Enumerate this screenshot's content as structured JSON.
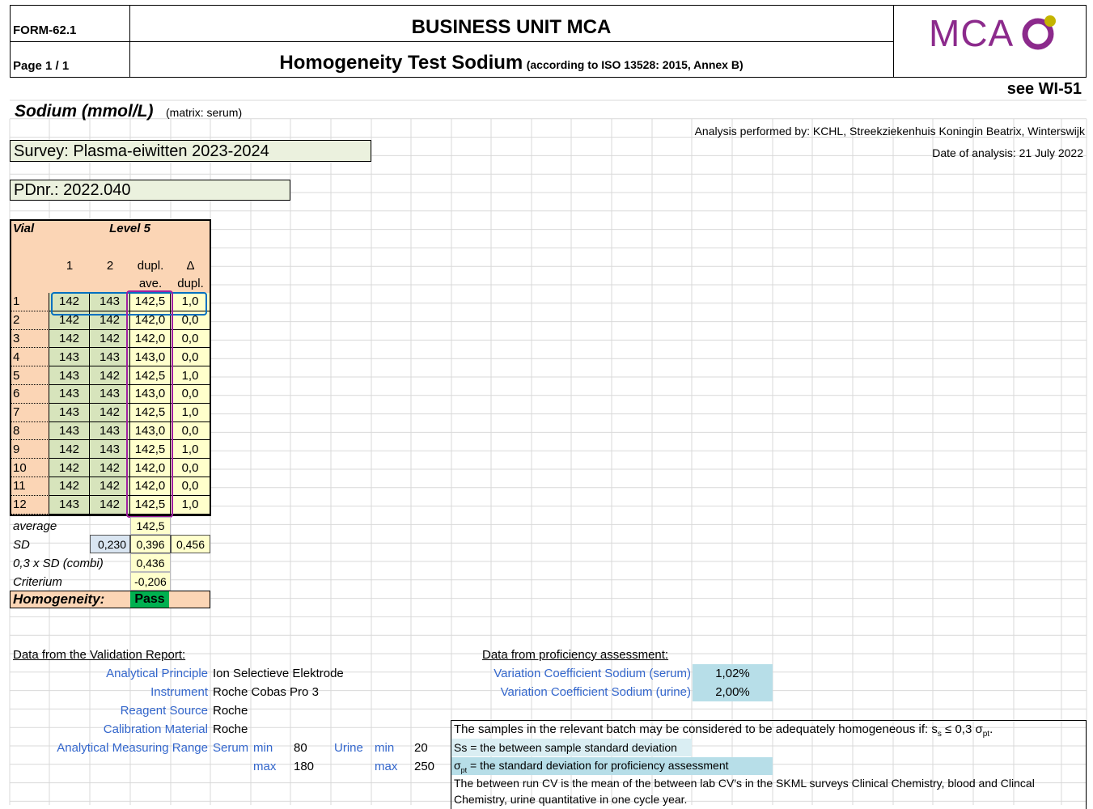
{
  "header": {
    "form_code": "FORM-62.1",
    "page": "Page 1 / 1",
    "unit": "BUSINESS UNIT MCA",
    "title": "Homogeneity Test Sodium",
    "subtitle": "(according to ISO 13528: 2015, Annex B)",
    "logo_text": "MCA",
    "see_wi": "see WI-51"
  },
  "analyte": {
    "name": "Sodium (mmol/L)",
    "matrix": "(matrix: serum)",
    "analysis_by": "Analysis performed by: KCHL, Streekziekenhuis Koningin Beatrix, Winterswijk",
    "date": "Date of analysis:  21 July 2022",
    "survey": "Survey: Plasma-eiwitten 2023-2024",
    "pdnr": "PDnr.: 2022.040"
  },
  "table": {
    "col_vial": "Vial",
    "col_level": "Level 5",
    "col_1": "1",
    "col_2": "2",
    "col_ave_1": "dupl.",
    "col_ave_2": "ave.",
    "col_delta_1": "Δ",
    "col_delta_2": "dupl.",
    "rows": [
      {
        "vial": "1",
        "v1": "142",
        "v2": "143",
        "ave": "142,5",
        "delta": "1,0"
      },
      {
        "vial": "2",
        "v1": "142",
        "v2": "142",
        "ave": "142,0",
        "delta": "0,0"
      },
      {
        "vial": "3",
        "v1": "142",
        "v2": "142",
        "ave": "142,0",
        "delta": "0,0"
      },
      {
        "vial": "4",
        "v1": "143",
        "v2": "143",
        "ave": "143,0",
        "delta": "0,0"
      },
      {
        "vial": "5",
        "v1": "143",
        "v2": "142",
        "ave": "142,5",
        "delta": "1,0"
      },
      {
        "vial": "6",
        "v1": "143",
        "v2": "143",
        "ave": "143,0",
        "delta": "0,0"
      },
      {
        "vial": "7",
        "v1": "143",
        "v2": "142",
        "ave": "142,5",
        "delta": "1,0"
      },
      {
        "vial": "8",
        "v1": "143",
        "v2": "143",
        "ave": "143,0",
        "delta": "0,0"
      },
      {
        "vial": "9",
        "v1": "142",
        "v2": "143",
        "ave": "142,5",
        "delta": "1,0"
      },
      {
        "vial": "10",
        "v1": "142",
        "v2": "142",
        "ave": "142,0",
        "delta": "0,0"
      },
      {
        "vial": "11",
        "v1": "142",
        "v2": "142",
        "ave": "142,0",
        "delta": "0,0"
      },
      {
        "vial": "12",
        "v1": "143",
        "v2": "142",
        "ave": "142,5",
        "delta": "1,0"
      }
    ]
  },
  "stats": {
    "average_label": "average",
    "average": "142,5",
    "sd_label": "SD",
    "sd_between": "0,230",
    "sd_ave": "0,396",
    "sd_delta": "0,456",
    "combi_label": "0,3 x SD (combi)",
    "combi": "0,436",
    "criterium_label": "Criterium",
    "criterium": "-0,206",
    "homogeneity_label": "Homogeneity:",
    "homogeneity": "Pass"
  },
  "validation": {
    "heading": "Data from the Validation Report:",
    "principle_label": "Analytical Principle",
    "principle": "Ion Selectieve Elektrode",
    "instrument_label": "Instrument",
    "instrument": "Roche Cobas Pro 3",
    "reagent_label": "Reagent Source",
    "reagent": "Roche",
    "calibration_label": "Calibration Material",
    "calibration": "Roche",
    "range_label": "Analytical Measuring Range",
    "serum_label": "Serum",
    "urine_label": "Urine",
    "min_label": "min",
    "max_label": "max",
    "serum_min": "80",
    "serum_max": "180",
    "urine_min": "20",
    "urine_max": "250"
  },
  "proficiency": {
    "heading": "Data from proficiency assessment:",
    "cv_serum_label": "Variation Coefficient Sodium (serum)",
    "cv_serum": "1,02%",
    "cv_urine_label": "Variation Coefficient Sodium (urine)",
    "cv_urine": "2,00%"
  },
  "notes": {
    "line1_prefix": "The samples in the relevant batch may be considered to be adequately homogeneous if: s",
    "line1_sub_s": "s",
    "line1_mid": " ≤ 0,3 σ",
    "line1_sub_pt": "pt",
    "line1_end": ".",
    "line2": "Ss = the between sample standard deviation",
    "line3_sigma": "σ",
    "line3_sub": "pt",
    "line3_rest": " = the standard deviation for proficiency assessment",
    "line4": "The between run CV is the mean of the between lab CV's in the SKML surveys Clinical Chemistry, blood and Clincal",
    "line5": "Chemistry, urine quantitative in one cycle year."
  },
  "colors": {
    "logo_purple": "#8c2a8c",
    "logo_yellow": "#c4b400",
    "header_orange": "#fbd5b5",
    "cell_green": "#d7e4bc",
    "cell_yellow": "#ffffcc",
    "sd_blue": "#d9e5f1",
    "pass_green": "#00b050",
    "highlight_blue": "#b7dee8",
    "label_blue": "#3366cc",
    "outline_blue": "#0070c0",
    "outline_purple": "#a020a0"
  }
}
